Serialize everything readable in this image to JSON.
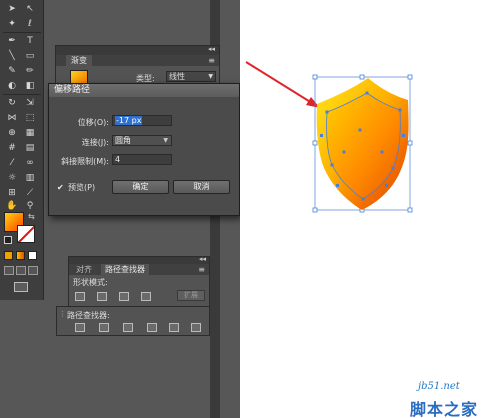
{
  "gradient_panel": {
    "tab": "渐变",
    "type_label": "类型:",
    "type_value": "线性",
    "menu": "≡",
    "collapse": "◂◂"
  },
  "offset_dialog": {
    "title": "偏移路径",
    "offset_label": "位移(O):",
    "offset_value": "-17 px",
    "joins_label": "连接(J):",
    "joins_value": "圆角",
    "miter_label": "斜接限制(M):",
    "miter_value": "4",
    "preview_label": "预览(P)",
    "preview_checked": true,
    "ok_label": "确定",
    "cancel_label": "取消"
  },
  "pathfinder_panel": {
    "tab_align": "对齐",
    "tab_pathfinder": "路径查找器",
    "shape_modes_label": "形状模式:",
    "expand_label": "扩展",
    "pathfinders_label": "路径查找器:",
    "collapse": "◂◂",
    "menu": "≡"
  },
  "watermark": {
    "domain": "jb51.net",
    "title": "脚本之家"
  },
  "colors": {
    "gradient_start": "#ffd21a",
    "gradient_end": "#e55300",
    "arrow": "#e0242b",
    "selection": "#4a7fd8"
  },
  "icons": [
    "selection-tool-icon",
    "direct-selection-tool-icon",
    "pen-tool-icon",
    "type-tool-icon",
    "line-tool-icon",
    "rectangle-tool-icon"
  ]
}
